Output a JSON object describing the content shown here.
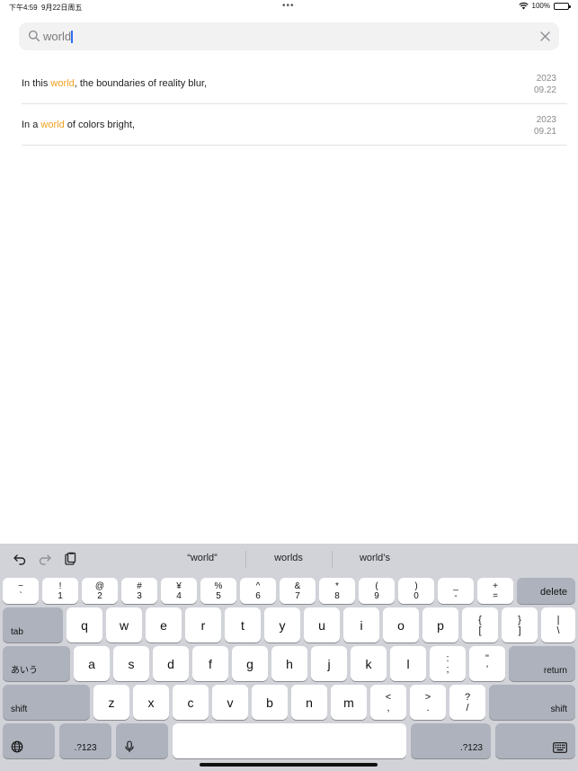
{
  "status_bar": {
    "time": "下午4:59",
    "date": "9月22日周五",
    "battery": "100%"
  },
  "search": {
    "value": "world",
    "placeholder": ""
  },
  "results": [
    {
      "before": "In this ",
      "match": "world",
      "after": ", the boundaries of reality blur,",
      "year": "2023",
      "date": "09.22"
    },
    {
      "before": "In a ",
      "match": "world",
      "after": " of colors bright,",
      "year": "2023",
      "date": "09.21"
    }
  ],
  "keyboard": {
    "suggestions": [
      "“world”",
      "worlds",
      "world’s"
    ],
    "number_row": [
      {
        "top": "~",
        "bottom": "`"
      },
      {
        "top": "!",
        "bottom": "1"
      },
      {
        "top": "@",
        "bottom": "2"
      },
      {
        "top": "#",
        "bottom": "3"
      },
      {
        "top": "¥",
        "bottom": "4"
      },
      {
        "top": "%",
        "bottom": "5"
      },
      {
        "top": "^",
        "bottom": "6"
      },
      {
        "top": "&",
        "bottom": "7"
      },
      {
        "top": "*",
        "bottom": "8"
      },
      {
        "top": "(",
        "bottom": "9"
      },
      {
        "top": ")",
        "bottom": "0"
      },
      {
        "top": "_",
        "bottom": "-"
      },
      {
        "top": "+",
        "bottom": "="
      }
    ],
    "delete": "delete",
    "tab": "tab",
    "row_q": [
      "q",
      "w",
      "e",
      "r",
      "t",
      "y",
      "u",
      "i",
      "o",
      "p"
    ],
    "row_q_extra": [
      {
        "top": "{",
        "bottom": "["
      },
      {
        "top": "}",
        "bottom": "]"
      },
      {
        "top": "|",
        "bottom": "\\"
      }
    ],
    "kana": "あいう",
    "row_a": [
      "a",
      "s",
      "d",
      "f",
      "g",
      "h",
      "j",
      "k",
      "l"
    ],
    "row_a_extra": [
      {
        "top": ":",
        "bottom": ";"
      },
      {
        "top": "\"",
        "bottom": "'"
      }
    ],
    "return": "return",
    "shift": "shift",
    "row_z": [
      "z",
      "x",
      "c",
      "v",
      "b",
      "n",
      "m"
    ],
    "row_z_extra": [
      {
        "top": "<",
        "bottom": ","
      },
      {
        "top": ">",
        "bottom": "."
      },
      {
        "top": "?",
        "bottom": "/"
      }
    ],
    "numbers_key": ".?123"
  }
}
